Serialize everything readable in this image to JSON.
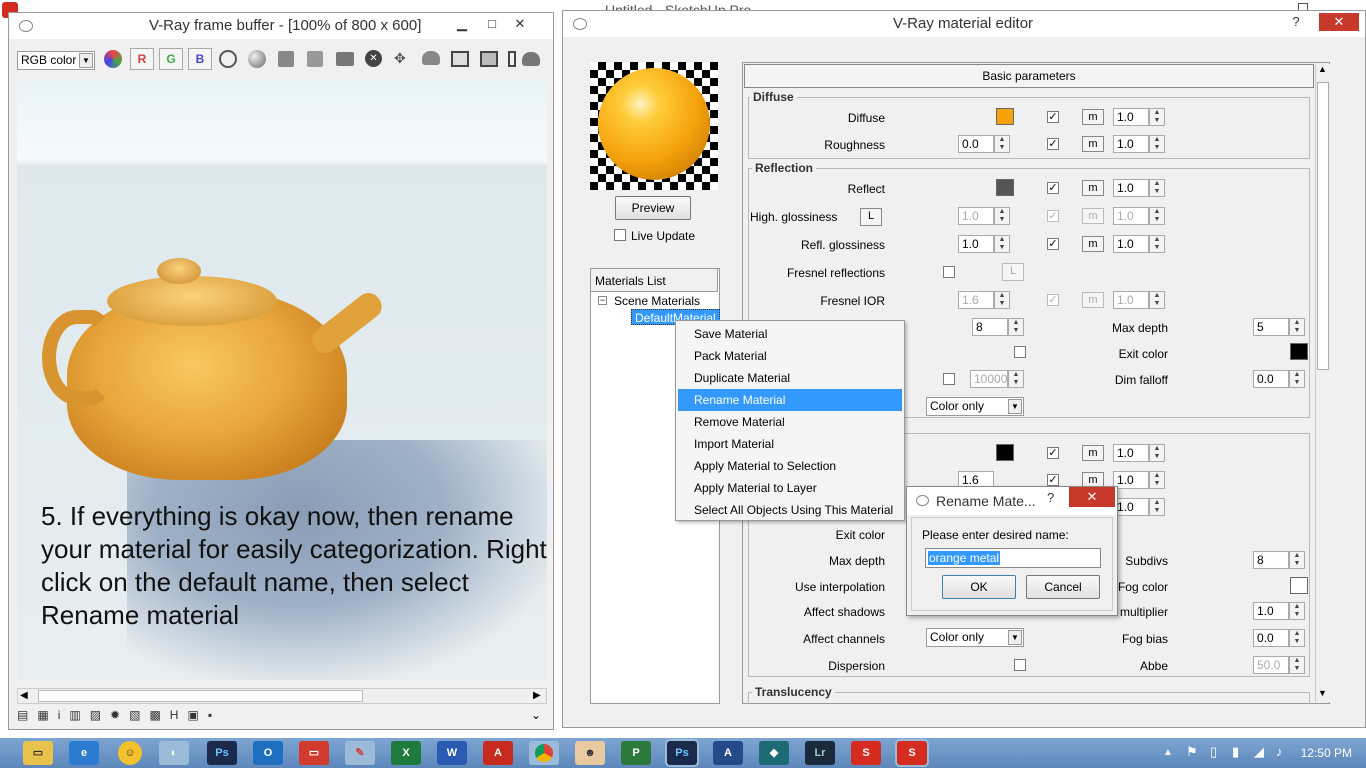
{
  "colors": {
    "accent": "#3399ff",
    "close": "#c7392b",
    "taskbar": "#6b95c6",
    "orange": "#f5a20c"
  },
  "sketchup": {
    "title": "Untitled - SketchUp Pro"
  },
  "framebuffer": {
    "title": "V-Ray frame buffer - [100% of 800 x 600]",
    "channel": "RGB color",
    "channel_buttons": [
      "R",
      "G",
      "B"
    ],
    "annotation": "5. If everything is okay now, then rename your material for easily categorization. Right click on the default name, then select Rename material"
  },
  "editor": {
    "title": "V-Ray material editor",
    "preview_button": "Preview",
    "live_update": "Live Update",
    "materials_list_title": "Materials List",
    "tree_root": "Scene Materials",
    "tree_item": "DefaultMaterial",
    "section_header": "Basic parameters",
    "diffuse": {
      "group": "Diffuse",
      "diffuse_label": "Diffuse",
      "diffuse_mult": "1.0",
      "roughness_label": "Roughness",
      "roughness_value": "0.0",
      "roughness_mult": "1.0"
    },
    "reflection": {
      "group": "Reflection",
      "reflect_label": "Reflect",
      "reflect_mult": "1.0",
      "hgloss_label": "High. glossiness",
      "hgloss_L": "L",
      "hgloss_value": "1.0",
      "hgloss_mult": "1.0",
      "rgloss_label": "Refl. glossiness",
      "rgloss_value": "1.0",
      "rgloss_mult": "1.0",
      "fresnel_label": "Fresnel reflections",
      "fresnel_L": "L",
      "fior_label": "Fresnel IOR",
      "fior_value": "1.6",
      "fior_mult": "1.0",
      "subdivs_value": "8",
      "maxdepth_label": "Max depth",
      "maxdepth_value": "5",
      "exitcolor_label": "Exit color",
      "dimdist_value": "100000",
      "dimfalloff_label": "Dim falloff",
      "dimfalloff_value": "0.0",
      "affect_value": "Color only"
    },
    "refraction": {
      "mult1": "1.0",
      "ior_value": "1.6",
      "mult2": "1.0",
      "mult3": "1.0",
      "exitcolor_label": "Exit color",
      "maxdepth_label": "Max depth",
      "subdivs_label": "Subdivs",
      "subdivs_value": "8",
      "useinterp_label": "Use interpolation",
      "fogcolor_label": "Fog color",
      "affectshadows_label": "Affect shadows",
      "fogmult_label": "multiplier",
      "fogmult_value": "1.0",
      "affectch_label": "Affect channels",
      "affectch_value": "Color only",
      "fogbias_label": "Fog bias",
      "fogbias_value": "0.0",
      "dispersion_label": "Dispersion",
      "abbe_label": "Abbe",
      "abbe_value": "50.0"
    },
    "translucency_group": "Translucency",
    "m_label": "m"
  },
  "context_menu": [
    "Save Material",
    "Pack Material",
    "Duplicate Material",
    "Rename Material",
    "Remove Material",
    "Import Material",
    "Apply Material to Selection",
    "Apply Material to Layer",
    "Select All Objects Using This Material"
  ],
  "context_menu_highlight": 3,
  "rename_dialog": {
    "title": "Rename Mate...",
    "help": "?",
    "prompt": "Please enter desired name:",
    "value": "orange metal",
    "ok": "OK",
    "cancel": "Cancel"
  },
  "taskbar": {
    "time": "12:50 PM"
  },
  "icons": [
    "sketchup-icon",
    "file-explorer-icon",
    "internet-explorer-icon",
    "photoshop-icon",
    "outlook-icon",
    "excel-icon",
    "word-icon",
    "acrobat-icon",
    "chrome-icon",
    "project-icon",
    "lightroom-icon"
  ]
}
